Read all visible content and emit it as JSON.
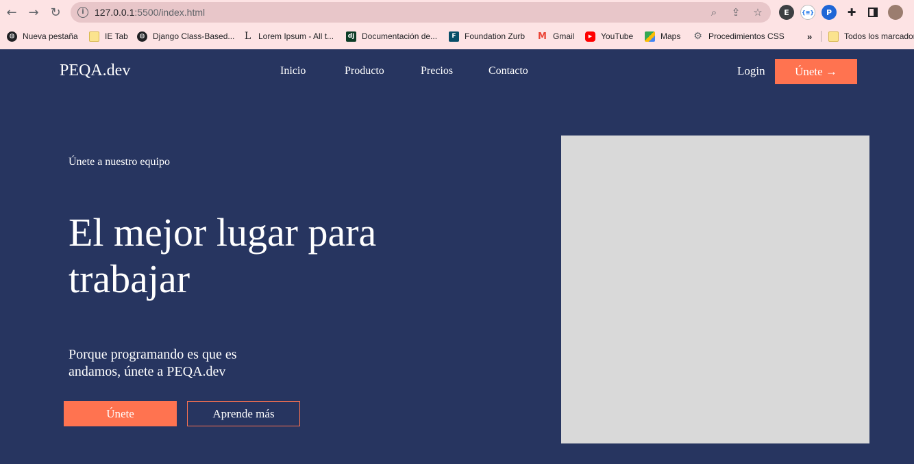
{
  "browser": {
    "url_host": "127.0.0.1",
    "url_path": ":5500/index.html",
    "bookmarks": [
      {
        "label": "Nueva pestaña",
        "icon": "globe-icon"
      },
      {
        "label": "IE Tab",
        "icon": "folder-icon"
      },
      {
        "label": "Django Class-Based...",
        "icon": "globe-icon"
      },
      {
        "label": "Lorem Ipsum - All t...",
        "icon": "lorem-icon"
      },
      {
        "label": "Documentación de...",
        "icon": "django-icon"
      },
      {
        "label": "Foundation Zurb",
        "icon": "foundation-icon"
      },
      {
        "label": "Gmail",
        "icon": "gmail-icon"
      },
      {
        "label": "YouTube",
        "icon": "youtube-icon"
      },
      {
        "label": "Maps",
        "icon": "maps-icon"
      },
      {
        "label": "Procedimientos CSS",
        "icon": "gear-icon"
      },
      {
        "label": "Todos los marcadores",
        "icon": "folder-icon"
      }
    ],
    "overflow_label": "»",
    "colors": {
      "chrome": "#fde3e4",
      "omnibox": "#e8c6c9"
    }
  },
  "site": {
    "logo": "PEQA.dev",
    "nav": [
      "Inicio",
      "Producto",
      "Precios",
      "Contacto"
    ],
    "login": "Login",
    "join_top": "Únete →",
    "eyebrow": "Únete a nuestro equipo",
    "title": "El mejor lugar para trabajar",
    "subtitle": "Porque programando es que es andamos, únete a PEQA.dev",
    "primary_button": "Únete",
    "secondary_button": "Aprende más",
    "colors": {
      "background": "#273560",
      "accent": "#ff7350",
      "placeholder": "#d9d9d9"
    }
  }
}
